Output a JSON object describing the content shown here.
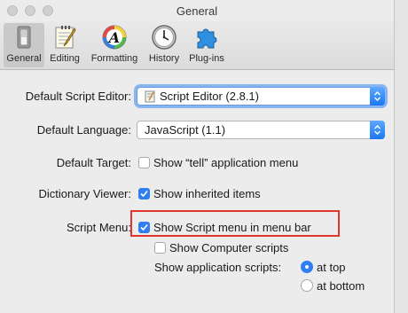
{
  "window": {
    "title": "General"
  },
  "toolbar": {
    "items": [
      {
        "label": "General",
        "icon": "general-switch-icon",
        "selected": true
      },
      {
        "label": "Editing",
        "icon": "notepad-pencil-icon",
        "selected": false
      },
      {
        "label": "Formatting",
        "icon": "color-font-icon",
        "selected": false
      },
      {
        "label": "History",
        "icon": "clock-icon",
        "selected": false
      },
      {
        "label": "Plug-ins",
        "icon": "puzzle-piece-icon",
        "selected": false
      }
    ]
  },
  "settings": {
    "default_editor": {
      "label": "Default Script Editor:",
      "value": "Script Editor (2.8.1)"
    },
    "default_language": {
      "label": "Default Language:",
      "value": "JavaScript (1.1)"
    },
    "default_target": {
      "label": "Default Target:",
      "option": "Show “tell” application menu",
      "checked": false
    },
    "dictionary_viewer": {
      "label": "Dictionary Viewer:",
      "option": "Show inherited items",
      "checked": true
    },
    "script_menu": {
      "label": "Script Menu:",
      "show_menu": {
        "text": "Show Script menu in menu bar",
        "checked": true
      },
      "show_computer": {
        "text": "Show Computer scripts",
        "checked": false
      },
      "app_scripts_label": "Show application scripts:",
      "options": [
        "at top",
        "at bottom"
      ],
      "selected": "at top"
    }
  },
  "colors": {
    "accent": "#2f7ff3",
    "highlight": "#e2352b"
  }
}
